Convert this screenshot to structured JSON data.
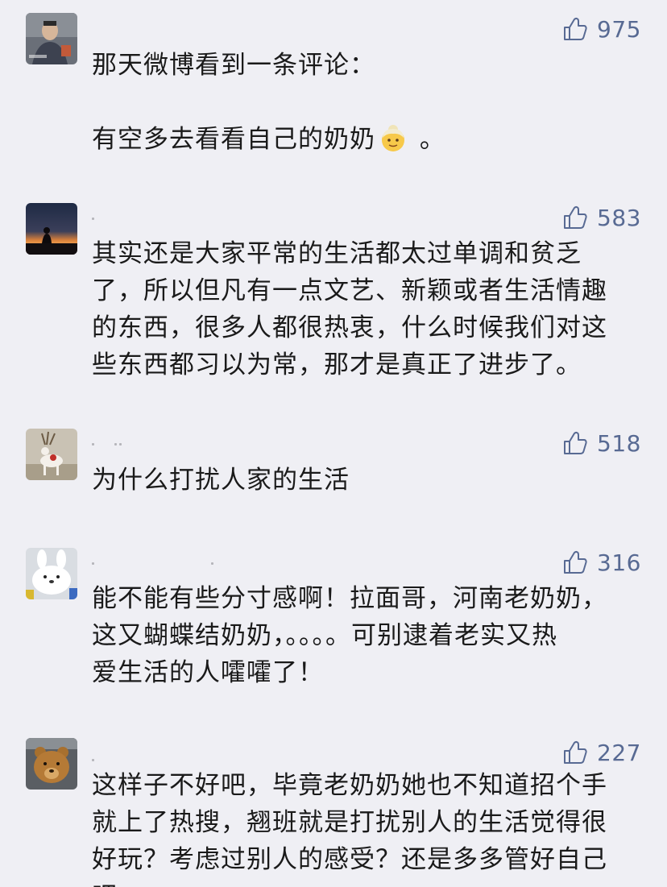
{
  "comments": [
    {
      "likes": "975",
      "lines": [
        "那天微博看到一条评论：",
        "",
        "有空多去看看自己的奶奶"
      ],
      "emoji": "older-woman-emoji",
      "tail": " 。"
    },
    {
      "likes": "583",
      "lines": [
        "其实还是大家平常的生活都太过单调和贫乏",
        "了，所以但凡有一点文艺、新颖或者生活情趣",
        "的东西，很多人都很热衷，什么时候我们对这",
        "些东西都习以为常，那才是真正了进步了。"
      ]
    },
    {
      "likes": "518",
      "lines": [
        "为什么打扰人家的生活"
      ]
    },
    {
      "likes": "316",
      "lines": [
        "能不能有些分寸感啊！拉面哥，河南老奶奶，",
        "这又蝴蝶结奶奶，。。。。可别逮着老实又热",
        "爱生活的人嚯嚯了！"
      ]
    },
    {
      "likes": "227",
      "lines": [
        "这样子不好吧，毕竟老奶奶她也不知道招个手",
        "就上了热搜，翘班就是打扰别人的生活觉得很",
        "好玩？考虑过别人的感受？还是多多管好自己",
        "吧。"
      ]
    }
  ]
}
